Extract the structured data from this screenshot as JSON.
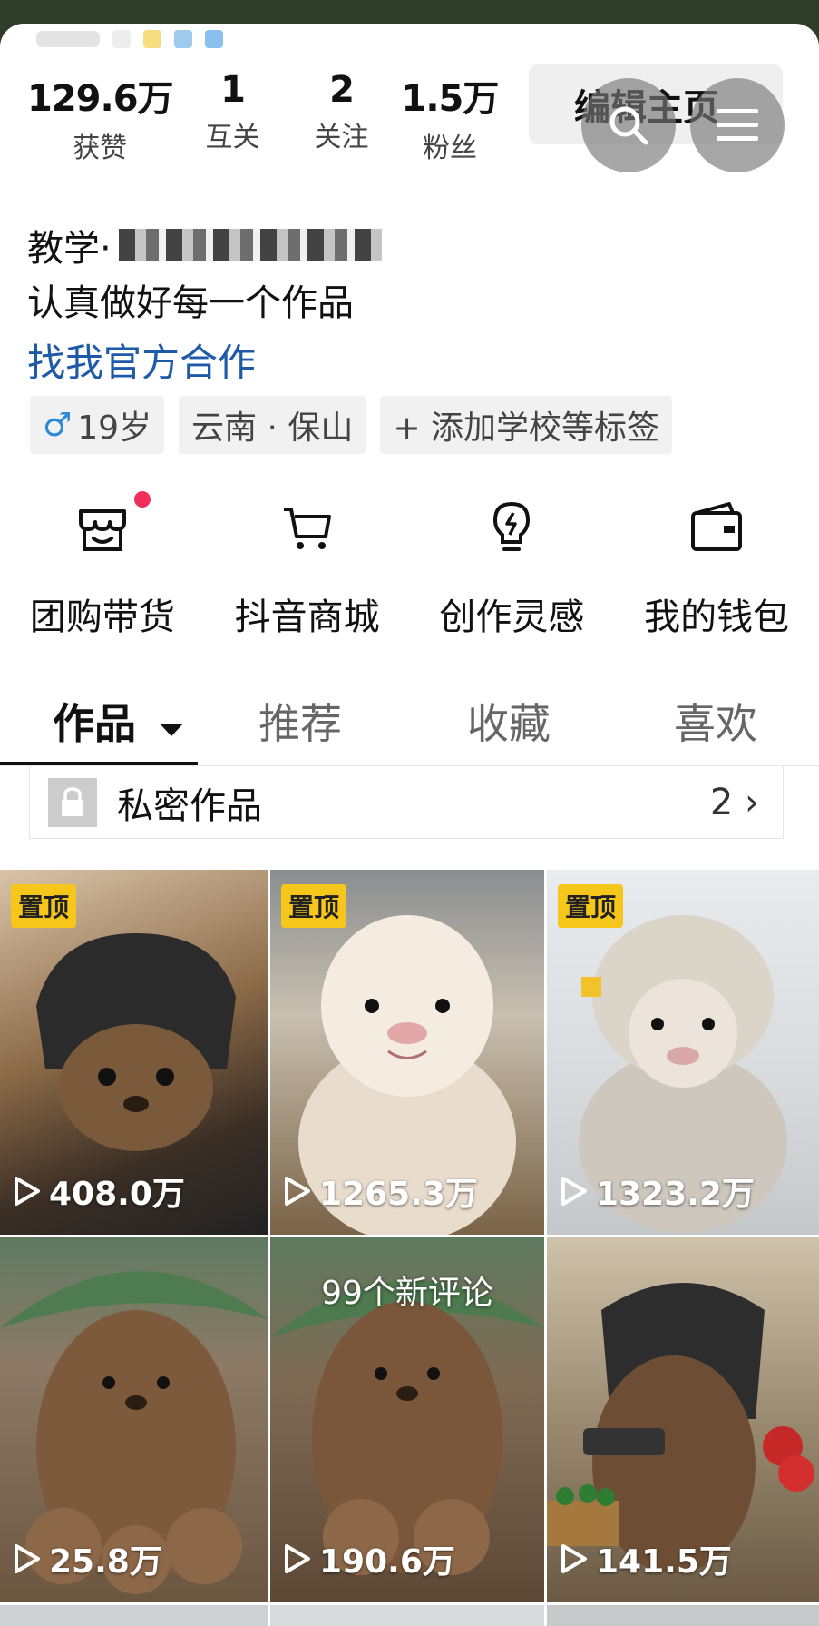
{
  "colors": {
    "link": "#1e5aa8",
    "pin_badge": "#f7c61a",
    "notify_dot": "#f0305a",
    "male": "#2a8ad8"
  },
  "stats": [
    {
      "value": "129.6万",
      "label": "获赞"
    },
    {
      "value": "1",
      "label": "互关"
    },
    {
      "value": "2",
      "label": "关注"
    },
    {
      "value": "1.5万",
      "label": "粉丝"
    }
  ],
  "edit_button": "编辑主页",
  "icons": {
    "search": "search-icon",
    "menu": "menu-icon"
  },
  "bio": {
    "name_prefix": "教学·",
    "line": "认真做好每一个作品",
    "link": "找我官方合作"
  },
  "tags": {
    "gender_symbol": "♂",
    "age": "19岁",
    "location": "云南 · 保山",
    "add": "+ 添加学校等标签"
  },
  "tools": [
    {
      "label": "团购带货",
      "icon": "shop-icon"
    },
    {
      "label": "抖音商城",
      "icon": "cart-icon"
    },
    {
      "label": "创作灵感",
      "icon": "bulb-icon"
    },
    {
      "label": "我的钱包",
      "icon": "wallet-icon"
    }
  ],
  "tabs": [
    "作品",
    "推荐",
    "收藏",
    "喜欢"
  ],
  "private_works": {
    "label": "私密作品",
    "count": "2 ›"
  },
  "videos": [
    {
      "pinned": "置顶",
      "views": "408.0万",
      "comments": ""
    },
    {
      "pinned": "置顶",
      "views": "1265.3万",
      "comments": ""
    },
    {
      "pinned": "置顶",
      "views": "1323.2万",
      "comments": ""
    },
    {
      "pinned": "",
      "views": "25.8万",
      "comments": ""
    },
    {
      "pinned": "",
      "views": "190.6万",
      "comments": "99个新评论"
    },
    {
      "pinned": "",
      "views": "141.5万",
      "comments": ""
    }
  ]
}
